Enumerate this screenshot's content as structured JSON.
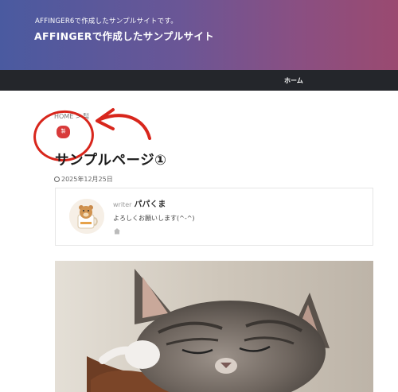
{
  "header": {
    "tagline": "AFFINGER6で作成したサンプルサイトです。",
    "site_title": "AFFINGERで作成したサンプルサイト",
    "gradient": [
      "#4a5aa0",
      "#9a4a70"
    ]
  },
  "nav": {
    "home": "ホーム",
    "bar_color": "#24262b"
  },
  "breadcrumb": {
    "home": "HOME",
    "separator": ">",
    "current": "製"
  },
  "category_badge": {
    "label": "製",
    "color": "#d83a3a"
  },
  "annotation": {
    "color": "#d8261c",
    "circle": "red-circle",
    "arrow": "red-arrow"
  },
  "post": {
    "title": "サンプルページ①",
    "date": "2025年12月25日"
  },
  "author": {
    "writer_label": "writer",
    "name": "パパくま",
    "message": "よろしくお願いします(^-^)",
    "icon": "home-icon"
  },
  "image": {
    "subject": "sleeping-kitten-photo"
  }
}
